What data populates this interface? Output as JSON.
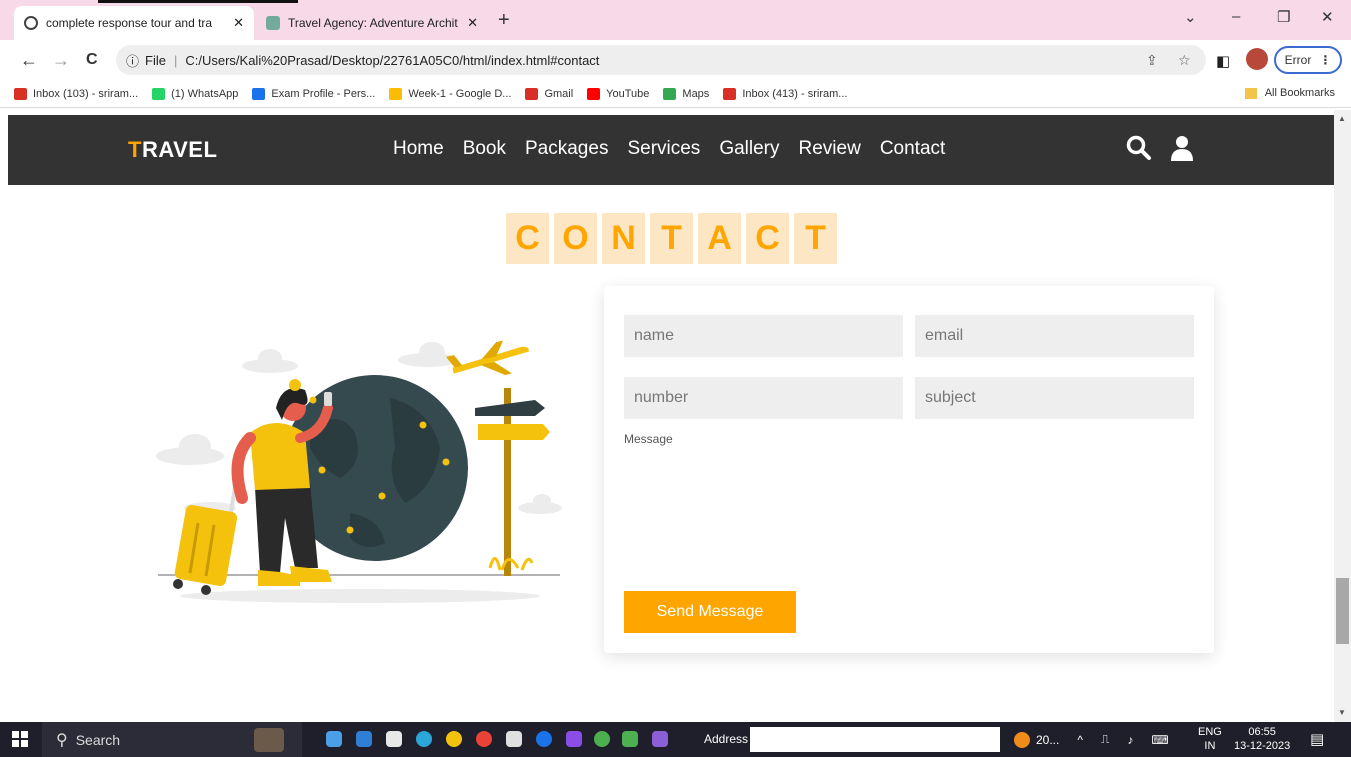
{
  "browser": {
    "tabs": [
      {
        "title": "complete response tour and tra",
        "close": "✕"
      },
      {
        "title": "Travel Agency: Adventure Archit",
        "close": "✕"
      }
    ],
    "new_tab": "+",
    "window_controls": {
      "minimize": "–",
      "restore": "❐",
      "close": "✕",
      "tab_search": "⌄"
    },
    "nav": {
      "back": "←",
      "forward": "→",
      "reload": "C"
    },
    "omnibox": {
      "info": "ⓘ",
      "scheme": "File",
      "url": "C:/Users/Kali%20Prasad/Desktop/22761A05C0/html/index.html#contact"
    },
    "error_label": "Error",
    "bookmarks": [
      {
        "label": "Inbox (103) - sriram...",
        "icon": "gmail-icon",
        "color": "#d93025"
      },
      {
        "label": "(1) WhatsApp",
        "icon": "whatsapp-icon",
        "color": "#25d366"
      },
      {
        "label": "Exam Profile - Pers...",
        "icon": "s-icon",
        "color": "#1a73e8"
      },
      {
        "label": "Week-1 - Google D...",
        "icon": "drive-icon",
        "color": "#fbbc04"
      },
      {
        "label": "Gmail",
        "icon": "gmail-icon",
        "color": "#d93025"
      },
      {
        "label": "YouTube",
        "icon": "youtube-icon",
        "color": "#ff0000"
      },
      {
        "label": "Maps",
        "icon": "maps-icon",
        "color": "#34a853"
      },
      {
        "label": "Inbox (413) - sriram...",
        "icon": "gmail-icon",
        "color": "#d93025"
      }
    ],
    "all_bookmarks": "All Bookmarks"
  },
  "site": {
    "logo_first": "T",
    "logo_rest": "RAVEL",
    "nav": [
      "Home",
      "Book",
      "Packages",
      "Services",
      "Gallery",
      "Review",
      "Contact"
    ],
    "heading_letters": [
      "C",
      "O",
      "N",
      "T",
      "A",
      "C",
      "T"
    ],
    "accent_color": "#ffa500",
    "form": {
      "name_placeholder": "name",
      "email_placeholder": "email",
      "number_placeholder": "number",
      "subject_placeholder": "subject",
      "message_label": "Message",
      "submit_label": "Send Message"
    }
  },
  "taskbar": {
    "search_label": "Search",
    "address_label": "Address",
    "weather": "20...",
    "lang_top": "ENG",
    "lang_bottom": "IN",
    "time": "06:55",
    "date": "13-12-2023"
  }
}
